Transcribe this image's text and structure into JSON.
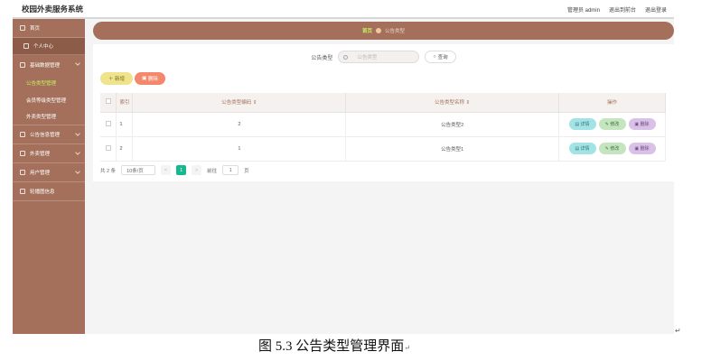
{
  "app": {
    "title": "校园外卖服务系统"
  },
  "header": {
    "admin_label": "管理员 admin",
    "link_frontend": "退出到前台",
    "link_logout": "退出登录"
  },
  "sidebar": {
    "home": "首页",
    "personal": "个人中心",
    "basic_data": "基础数据管理",
    "basic_children": [
      "公告类型管理",
      "会员等级类型管理",
      "外卖类型管理"
    ],
    "notice_info": "公告信息管理",
    "takeout": "外卖管理",
    "users": "用户管理",
    "carousel": "轮播图信息"
  },
  "breadcrumb": {
    "home": "首页",
    "current": "公告类型"
  },
  "search": {
    "label": "公告类型",
    "placeholder": "公告类型",
    "button": "查询"
  },
  "actions": {
    "add": "新增",
    "delete": "删除"
  },
  "table": {
    "headers": {
      "index": "索引",
      "code": "公告类型编码",
      "name": "公告类型名称",
      "operation": "操作"
    },
    "rows": [
      {
        "index": "1",
        "code": "2",
        "name": "公告类型2"
      },
      {
        "index": "2",
        "code": "1",
        "name": "公告类型1"
      }
    ],
    "row_buttons": {
      "detail": "详情",
      "edit": "修改",
      "remove": "删除"
    }
  },
  "pagination": {
    "total": "共 2 条",
    "page_size": "10条/页",
    "prev": "<",
    "current_page": "1",
    "next": ">",
    "goto_label": "前往",
    "goto_value": "1",
    "page_suffix": "页"
  },
  "caption": {
    "text": "图 5.3 公告类型管理界面",
    "return_mark": "↵"
  },
  "colors": {
    "sidebar": "#a4705b",
    "active_text": "#c6f25d",
    "page_active": "#17b890"
  }
}
